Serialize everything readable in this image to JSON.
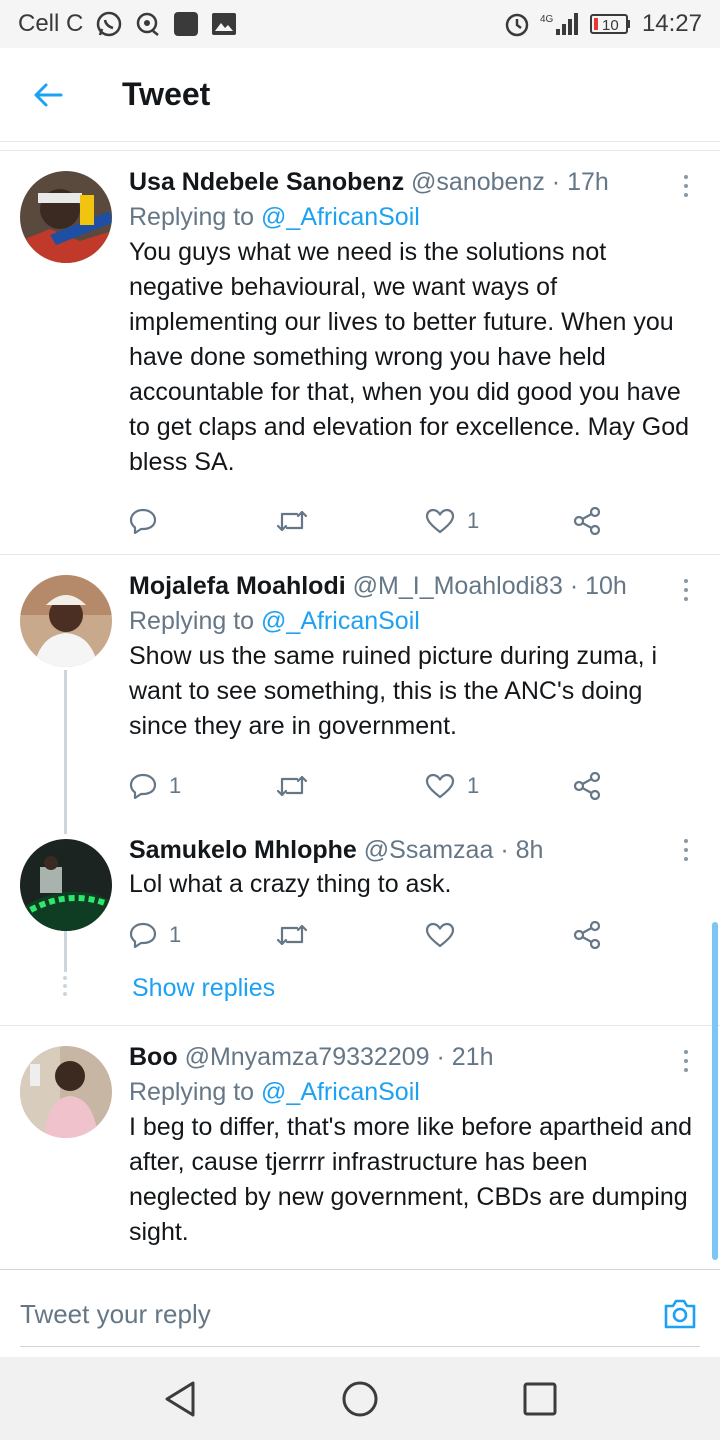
{
  "status_bar": {
    "carrier": "Cell C",
    "network": "4G",
    "battery": "10",
    "time": "14:27"
  },
  "header": {
    "title": "Tweet"
  },
  "tweets": [
    {
      "name": "Usa Ndebele Sanobenz",
      "handle": "@sanobenz",
      "time": "· 17h",
      "replying_prefix": "Replying to ",
      "replying_to": "@_AfricanSoil",
      "text": "You guys what we need is the solutions not negative behavioural, we want ways of implementing our lives to better future. When you have done something wrong you have held accountable for that, when you did good you have to get claps and elevation for excellence. May God bless SA.",
      "reply_count": "",
      "retweet_count": "",
      "like_count": "1"
    },
    {
      "name": "Mojalefa Moahlodi",
      "handle": "@M_I_Moahlodi83",
      "time": "· 10h",
      "replying_prefix": "Replying to ",
      "replying_to": "@_AfricanSoil",
      "text": "Show us the same ruined picture during zuma, i want to see something, this is the ANC's doing since they are in government.",
      "reply_count": "1",
      "retweet_count": "",
      "like_count": "1"
    },
    {
      "name": "Samukelo Mhlophe",
      "handle": "@Ssamzaa",
      "time": "· 8h",
      "text": "Lol what a crazy thing to ask.",
      "reply_count": "1",
      "retweet_count": "",
      "like_count": ""
    },
    {
      "name": "Boo",
      "handle": "@Mnyamza79332209",
      "time": "· 21h",
      "replying_prefix": "Replying to ",
      "replying_to": "@_AfricanSoil",
      "text": "I beg to differ, that's more like before apartheid and after, cause tjerrrr infrastructure has been neglected by new government, CBDs are dumping sight."
    }
  ],
  "show_replies_label": "Show replies",
  "reply_bar": {
    "placeholder": "Tweet your reply"
  },
  "colors": {
    "accent": "#1da1f2",
    "secondary_text": "#657786",
    "divider": "#e1e8ed"
  },
  "icons": [
    "whatsapp-icon",
    "location-icon",
    "notification-icon",
    "gallery-icon",
    "alarm-icon",
    "signal-icon",
    "battery-icon",
    "back-arrow-icon",
    "more-vertical-icon",
    "reply-icon",
    "retweet-icon",
    "like-icon",
    "share-icon",
    "camera-icon",
    "nav-back-icon",
    "nav-home-icon",
    "nav-recents-icon"
  ]
}
